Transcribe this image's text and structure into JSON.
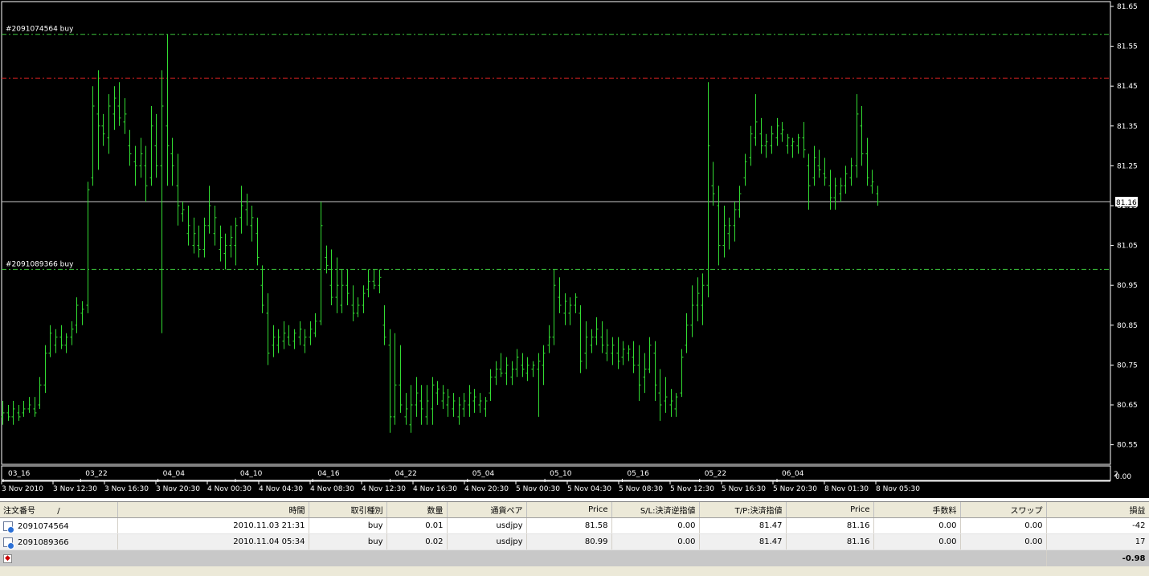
{
  "chart": {
    "price_scale": [
      "81.65",
      "81.55",
      "81.45",
      "81.35",
      "81.25",
      "81.15",
      "81.05",
      "80.95",
      "80.85",
      "80.75",
      "80.65",
      "80.55"
    ],
    "current_price": "81.16",
    "current_price_value": 81.16,
    "y_range": [
      80.52,
      81.66
    ],
    "order_lines": [
      {
        "label": "#2091074564 buy",
        "price": 81.58,
        "color": "#3cc83c"
      },
      {
        "label": "#2091089366 buy",
        "price": 80.99,
        "color": "#3cc83c"
      }
    ],
    "tp_line": {
      "price": 81.47,
      "color": "#d02020"
    },
    "upper_x_labels": [
      "03_16",
      "03_22",
      "04_04",
      "04_10",
      "04_16",
      "04_22",
      "05_04",
      "05_10",
      "05_16",
      "05_22",
      "06_04"
    ],
    "time_labels": [
      "3 Nov 2010",
      "3 Nov 12:30",
      "3 Nov 16:30",
      "3 Nov 20:30",
      "4 Nov 00:30",
      "4 Nov 04:30",
      "4 Nov 08:30",
      "4 Nov 12:30",
      "4 Nov 16:30",
      "4 Nov 20:30",
      "5 Nov 00:30",
      "5 Nov 04:30",
      "5 Nov 08:30",
      "5 Nov 12:30",
      "5 Nov 16:30",
      "5 Nov 20:30",
      "8 Nov 01:30",
      "8 Nov 05:30"
    ],
    "corner_label_top": "2",
    "corner_label_bottom": "0.00",
    "bar_color": "#32dc32",
    "bars": [
      [
        80.66,
        80.6,
        80.62,
        80.63
      ],
      [
        80.65,
        80.61,
        80.63,
        80.62
      ],
      [
        80.66,
        80.6,
        80.62,
        80.64
      ],
      [
        80.65,
        80.61,
        80.63,
        80.62
      ],
      [
        80.66,
        80.62,
        80.63,
        80.64
      ],
      [
        80.67,
        80.63,
        80.64,
        80.65
      ],
      [
        80.67,
        80.62,
        80.64,
        80.63
      ],
      [
        80.72,
        80.64,
        80.65,
        80.7
      ],
      [
        80.8,
        80.68,
        80.7,
        80.78
      ],
      [
        80.85,
        80.77,
        80.78,
        80.83
      ],
      [
        80.84,
        80.78,
        80.8,
        80.82
      ],
      [
        80.85,
        80.79,
        80.82,
        80.8
      ],
      [
        80.83,
        80.78,
        80.8,
        80.82
      ],
      [
        80.86,
        80.8,
        80.82,
        80.84
      ],
      [
        80.92,
        80.83,
        80.85,
        80.9
      ],
      [
        80.91,
        80.85,
        80.88,
        80.89
      ],
      [
        81.21,
        80.88,
        80.9,
        81.19
      ],
      [
        81.45,
        81.2,
        81.22,
        81.4
      ],
      [
        81.49,
        81.24,
        81.38,
        81.35
      ],
      [
        81.38,
        81.3,
        81.35,
        81.33
      ],
      [
        81.43,
        81.28,
        81.32,
        81.4
      ],
      [
        81.45,
        81.34,
        81.38,
        81.42
      ],
      [
        81.46,
        81.35,
        81.4,
        81.37
      ],
      [
        81.42,
        81.33,
        81.36,
        81.38
      ],
      [
        81.34,
        81.25,
        81.3,
        81.28
      ],
      [
        81.3,
        81.2,
        81.26,
        81.25
      ],
      [
        81.32,
        81.22,
        81.25,
        81.28
      ],
      [
        81.3,
        81.16,
        81.25,
        81.2
      ],
      [
        81.4,
        81.2,
        81.22,
        81.35
      ],
      [
        81.38,
        81.22,
        81.3,
        81.25
      ],
      [
        81.49,
        80.83,
        81.25,
        81.4
      ],
      [
        81.58,
        81.2,
        81.35,
        81.3
      ],
      [
        81.32,
        81.2,
        81.28,
        81.25
      ],
      [
        81.28,
        81.1,
        81.2,
        81.15
      ],
      [
        81.16,
        81.11,
        81.13,
        81.14
      ],
      [
        81.15,
        81.05,
        81.08,
        81.1
      ],
      [
        81.12,
        81.03,
        81.05,
        81.08
      ],
      [
        81.1,
        81.02,
        81.05,
        81.04
      ],
      [
        81.12,
        81.02,
        81.04,
        81.1
      ],
      [
        81.2,
        81.08,
        81.1,
        81.15
      ],
      [
        81.15,
        81.05,
        81.08,
        81.12
      ],
      [
        81.1,
        81.01,
        81.04,
        81.07
      ],
      [
        81.08,
        80.99,
        81.03,
        81.05
      ],
      [
        81.1,
        81.02,
        81.05,
        81.07
      ],
      [
        81.12,
        81.0,
        81.05,
        81.1
      ],
      [
        81.2,
        81.08,
        81.12,
        81.15
      ],
      [
        81.18,
        81.1,
        81.14,
        81.16
      ],
      [
        81.15,
        81.06,
        81.1,
        81.12
      ],
      [
        81.12,
        81.0,
        81.08,
        81.02
      ],
      [
        81.0,
        80.88,
        80.95,
        80.9
      ],
      [
        80.93,
        80.75,
        80.88,
        80.78
      ],
      [
        80.85,
        80.77,
        80.8,
        80.82
      ],
      [
        80.84,
        80.78,
        80.8,
        80.82
      ],
      [
        80.86,
        80.79,
        80.81,
        80.83
      ],
      [
        80.85,
        80.8,
        80.82,
        80.8
      ],
      [
        80.84,
        80.79,
        80.81,
        80.83
      ],
      [
        80.86,
        80.8,
        80.82,
        80.84
      ],
      [
        80.84,
        80.78,
        80.8,
        80.82
      ],
      [
        80.86,
        80.8,
        80.82,
        80.84
      ],
      [
        80.88,
        80.82,
        80.83,
        80.86
      ],
      [
        81.16,
        80.85,
        80.86,
        81.1
      ],
      [
        81.05,
        80.98,
        81.02,
        81.0
      ],
      [
        81.04,
        80.9,
        80.95,
        80.92
      ],
      [
        81.02,
        80.88,
        80.92,
        80.95
      ],
      [
        80.99,
        80.88,
        80.9,
        80.95
      ],
      [
        80.99,
        80.9,
        80.95,
        80.93
      ],
      [
        80.95,
        80.86,
        80.9,
        80.88
      ],
      [
        80.92,
        80.87,
        80.88,
        80.9
      ],
      [
        80.95,
        80.88,
        80.9,
        80.93
      ],
      [
        80.99,
        80.92,
        80.94,
        80.96
      ],
      [
        80.99,
        80.94,
        80.96,
        80.95
      ],
      [
        80.99,
        80.93,
        80.95,
        80.97
      ],
      [
        80.9,
        80.8,
        80.85,
        80.82
      ],
      [
        80.84,
        80.58,
        80.8,
        80.62
      ],
      [
        80.83,
        80.6,
        80.62,
        80.7
      ],
      [
        80.8,
        80.63,
        80.7,
        80.65
      ],
      [
        80.68,
        80.6,
        80.62,
        80.64
      ],
      [
        80.7,
        80.58,
        80.6,
        80.65
      ],
      [
        80.72,
        80.62,
        80.65,
        80.68
      ],
      [
        80.7,
        80.6,
        80.66,
        80.64
      ],
      [
        80.7,
        80.6,
        80.62,
        80.66
      ],
      [
        80.72,
        80.6,
        80.64,
        80.7
      ],
      [
        80.71,
        80.65,
        80.68,
        80.69
      ],
      [
        80.7,
        80.64,
        80.66,
        80.68
      ],
      [
        80.69,
        80.62,
        80.65,
        80.67
      ],
      [
        80.68,
        80.62,
        80.64,
        80.66
      ],
      [
        80.67,
        80.6,
        80.62,
        80.65
      ],
      [
        80.68,
        80.62,
        80.64,
        80.66
      ],
      [
        80.7,
        80.62,
        80.65,
        80.68
      ],
      [
        80.69,
        80.63,
        80.66,
        80.67
      ],
      [
        80.68,
        80.63,
        80.65,
        80.66
      ],
      [
        80.67,
        80.62,
        80.64,
        80.66
      ],
      [
        80.74,
        80.66,
        80.68,
        80.72
      ],
      [
        80.76,
        80.7,
        80.72,
        80.74
      ],
      [
        80.78,
        80.72,
        80.74,
        80.73
      ],
      [
        80.77,
        80.7,
        80.73,
        80.75
      ],
      [
        80.76,
        80.7,
        80.72,
        80.74
      ],
      [
        80.79,
        80.72,
        80.74,
        80.77
      ],
      [
        80.78,
        80.72,
        80.75,
        80.74
      ],
      [
        80.77,
        80.71,
        80.73,
        80.75
      ],
      [
        80.76,
        80.72,
        80.74,
        80.75
      ],
      [
        80.78,
        80.62,
        80.74,
        80.76
      ],
      [
        80.8,
        80.7,
        80.75,
        80.78
      ],
      [
        80.85,
        80.78,
        80.8,
        80.82
      ],
      [
        80.99,
        80.8,
        80.82,
        80.95
      ],
      [
        80.97,
        80.88,
        80.92,
        80.9
      ],
      [
        80.93,
        80.85,
        80.88,
        80.91
      ],
      [
        80.92,
        80.85,
        80.88,
        80.9
      ],
      [
        80.93,
        80.88,
        80.9,
        80.92
      ],
      [
        80.9,
        80.73,
        80.88,
        80.76
      ],
      [
        80.86,
        80.74,
        80.78,
        80.82
      ],
      [
        80.84,
        80.78,
        80.8,
        80.82
      ],
      [
        80.87,
        80.8,
        80.82,
        80.84
      ],
      [
        80.86,
        80.78,
        80.82,
        80.8
      ],
      [
        80.84,
        80.76,
        80.78,
        80.8
      ],
      [
        80.82,
        80.75,
        80.78,
        80.8
      ],
      [
        80.82,
        80.74,
        80.78,
        80.76
      ],
      [
        80.81,
        80.75,
        80.77,
        80.79
      ],
      [
        80.8,
        80.76,
        80.78,
        80.79
      ],
      [
        80.81,
        80.73,
        80.77,
        80.75
      ],
      [
        80.8,
        80.66,
        80.75,
        80.7
      ],
      [
        80.78,
        80.68,
        80.72,
        80.74
      ],
      [
        80.82,
        80.73,
        80.74,
        80.8
      ],
      [
        80.81,
        80.66,
        80.78,
        80.7
      ],
      [
        80.74,
        80.61,
        80.68,
        80.65
      ],
      [
        80.72,
        80.63,
        80.66,
        80.67
      ],
      [
        80.69,
        80.62,
        80.65,
        80.66
      ],
      [
        80.68,
        80.62,
        80.64,
        80.67
      ],
      [
        80.79,
        80.67,
        80.68,
        80.77
      ],
      [
        80.88,
        80.78,
        80.8,
        80.85
      ],
      [
        80.95,
        80.82,
        80.85,
        80.9
      ],
      [
        80.97,
        80.86,
        80.9,
        80.93
      ],
      [
        80.98,
        80.85,
        80.9,
        80.95
      ],
      [
        81.46,
        80.92,
        80.95,
        81.3
      ],
      [
        81.26,
        81.15,
        81.2,
        81.18
      ],
      [
        81.2,
        81.0,
        81.15,
        81.05
      ],
      [
        81.15,
        81.02,
        81.05,
        81.1
      ],
      [
        81.12,
        81.04,
        81.08,
        81.1
      ],
      [
        81.16,
        81.06,
        81.1,
        81.14
      ],
      [
        81.2,
        81.12,
        81.14,
        81.18
      ],
      [
        81.28,
        81.2,
        81.22,
        81.26
      ],
      [
        81.35,
        81.25,
        81.27,
        81.33
      ],
      [
        81.43,
        81.3,
        81.32,
        81.36
      ],
      [
        81.37,
        81.28,
        81.33,
        81.3
      ],
      [
        81.33,
        81.27,
        81.3,
        81.31
      ],
      [
        81.35,
        81.28,
        81.3,
        81.33
      ],
      [
        81.37,
        81.3,
        81.32,
        81.35
      ],
      [
        81.36,
        81.31,
        81.33,
        81.34
      ],
      [
        81.33,
        81.28,
        81.3,
        81.32
      ],
      [
        81.32,
        81.27,
        81.3,
        81.31
      ],
      [
        81.33,
        81.28,
        81.3,
        81.32
      ],
      [
        81.36,
        81.27,
        81.32,
        81.29
      ],
      [
        81.28,
        81.14,
        81.25,
        81.2
      ],
      [
        81.3,
        81.2,
        81.22,
        81.27
      ],
      [
        81.29,
        81.22,
        81.25,
        81.24
      ],
      [
        81.27,
        81.2,
        81.23,
        81.22
      ],
      [
        81.24,
        81.14,
        81.2,
        81.17
      ],
      [
        81.22,
        81.14,
        81.17,
        81.2
      ],
      [
        81.22,
        81.16,
        81.18,
        81.2
      ],
      [
        81.25,
        81.18,
        81.2,
        81.23
      ],
      [
        81.27,
        81.2,
        81.22,
        81.25
      ],
      [
        81.43,
        81.22,
        81.25,
        81.38
      ],
      [
        81.4,
        81.25,
        81.35,
        81.28
      ],
      [
        81.32,
        81.2,
        81.28,
        81.22
      ],
      [
        81.24,
        81.18,
        81.2,
        81.21
      ],
      [
        81.2,
        81.15,
        81.18,
        81.16
      ]
    ]
  },
  "terminal": {
    "headers": [
      "注文番号",
      "時間",
      "取引種別",
      "数量",
      "通貨ペア",
      "Price",
      "S/L:決済逆指値",
      "T/P:決済指値",
      "Price",
      "手数料",
      "スワップ",
      "損益"
    ],
    "header_sort_indicator": "/",
    "rows": [
      {
        "ticket": "2091074564",
        "time": "2010.11.03 21:31",
        "type": "buy",
        "size": "0.01",
        "symbol": "usdjpy",
        "price": "81.58",
        "sl": "0.00",
        "tp": "81.47",
        "cur_price": "81.16",
        "commission": "0.00",
        "swap": "0.00",
        "profit": "-42"
      },
      {
        "ticket": "2091089366",
        "time": "2010.11.04 05:34",
        "type": "buy",
        "size": "0.02",
        "symbol": "usdjpy",
        "price": "80.99",
        "sl": "0.00",
        "tp": "81.47",
        "cur_price": "81.16",
        "commission": "0.00",
        "swap": "0.00",
        "profit": "17"
      }
    ],
    "total": "-0.98"
  }
}
